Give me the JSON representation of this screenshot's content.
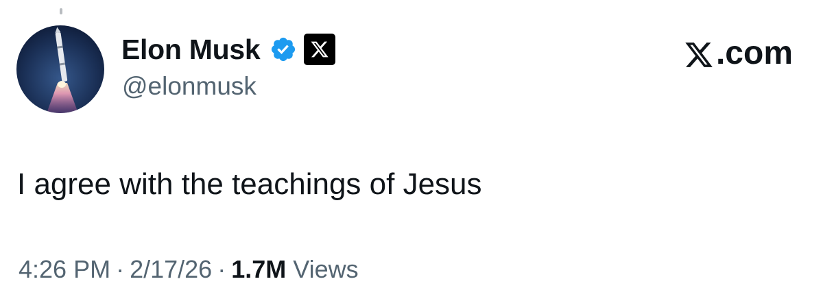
{
  "tweet": {
    "author": {
      "display_name": "Elon Musk",
      "handle": "@elonmusk",
      "verified_badge_icon": "verified-checkmark-icon",
      "affiliate_badge_icon": "x-logo-icon",
      "avatar_icon": "rocket-launch-avatar"
    },
    "brand": {
      "logo_icon": "x-logo-icon",
      "text": ".com"
    },
    "text": "I agree with the teachings of Jesus",
    "meta": {
      "time": "4:26 PM",
      "separator": "·",
      "date": "2/17/26",
      "views_count": "1.7M",
      "views_label": "Views"
    }
  },
  "colors": {
    "text_primary": "#0f1419",
    "text_secondary": "#536471",
    "verified_blue": "#1d9bf0",
    "background": "#ffffff"
  }
}
